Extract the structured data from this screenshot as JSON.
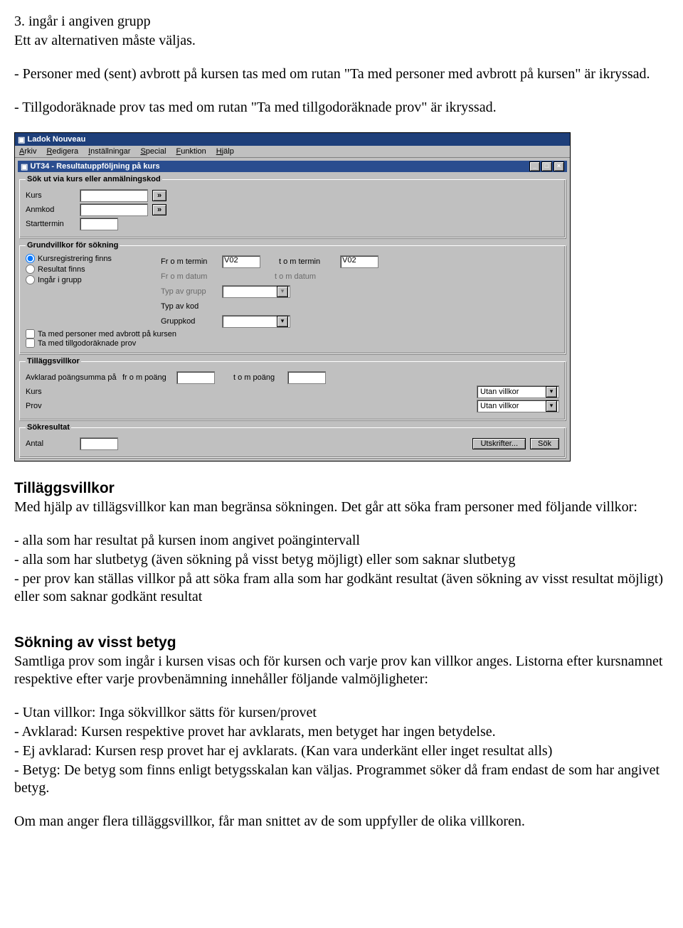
{
  "intro": {
    "l1": "3. ingår i angiven grupp",
    "l2": "Ett av alternativen måste väljas.",
    "l3": "- Personer med (sent) avbrott på kursen tas med om rutan \"Ta med personer med avbrott på kursen\" är ikryssad.",
    "l4": "- Tillgodoräknade prov tas med om rutan \"Ta med tillgodoräknade prov\" är ikryssad."
  },
  "app": {
    "title": "Ladok Nouveau",
    "menu": {
      "arkiv": "Arkiv",
      "redigera": "Redigera",
      "installningar": "Inställningar",
      "special": "Special",
      "funktion": "Funktion",
      "hjalp": "Hjälp"
    },
    "mdi_title": "UT34 - Resultatuppföljning på kurs",
    "groups": {
      "sok": {
        "legend": "Sök ut via kurs eller anmälningskod",
        "kurs": "Kurs",
        "anmkod": "Anmkod",
        "starttermin": "Starttermin"
      },
      "grund": {
        "legend": "Grundvillkor för sökning",
        "radios": {
          "r1": "Kursregistrering finns",
          "r2": "Resultat finns",
          "r3": "Ingår i grupp"
        },
        "fields": {
          "f1": "Fr o m termin",
          "f1v": "V02",
          "f2": "t o m termin",
          "f2v": "V02",
          "f3": "Fr o m datum",
          "f4": "t o m datum",
          "f5": "Typ av grupp",
          "f6": "Typ av kod",
          "f7": "Gruppkod"
        },
        "checks": {
          "c1": "Ta med personer med avbrott på kursen",
          "c2": "Ta med tillgodoräknade prov"
        }
      },
      "till": {
        "legend": "Tilläggsvillkor",
        "avklarad": "Avklarad poängsumma på",
        "from": "fr o m poäng",
        "tom": "t o m poäng",
        "kurs": "Kurs",
        "prov": "Prov",
        "utan": "Utan villkor"
      },
      "res": {
        "legend": "Sökresultat",
        "antal": "Antal",
        "utskrifter": "Utskrifter...",
        "sok": "Sök"
      }
    }
  },
  "sec1": {
    "h": "Tilläggsvillkor",
    "p1": "Med hjälp av tillägsvillkor kan man begränsa sökningen. Det går att söka fram personer med följande villkor:",
    "b1": "- alla som har resultat på kursen inom angivet poängintervall",
    "b2": "- alla som har slutbetyg (även sökning på visst betyg möjligt) eller   som saknar slutbetyg",
    "b3": "- per prov kan ställas villkor på att söka fram alla som har godkänt   resultat (även sökning av visst resultat möjligt) eller som saknar godkänt resultat"
  },
  "sec2": {
    "h": "Sökning av visst betyg",
    "p1": "Samtliga prov som ingår i kursen visas och för kursen och varje prov kan villkor anges. Listorna efter kursnamnet respektive efter varje provbenämning innehåller följande valmöjligheter:",
    "b1": "- Utan villkor: Inga sökvillkor sätts för kursen/provet",
    "b2": "- Avklarad: Kursen respektive provet har avklarats, men betyget har ingen betydelse.",
    "b3": "- Ej avklarad: Kursen resp provet har ej avklarats. (Kan vara underkänt eller inget resultat alls)",
    "b4": "- Betyg: De betyg som finns enligt betygsskalan kan väljas. Programmet söker då fram endast de som har angivet betyg.",
    "p2": "Om man anger flera tilläggsvillkor, får man snittet av de som uppfyller de olika villkoren."
  }
}
